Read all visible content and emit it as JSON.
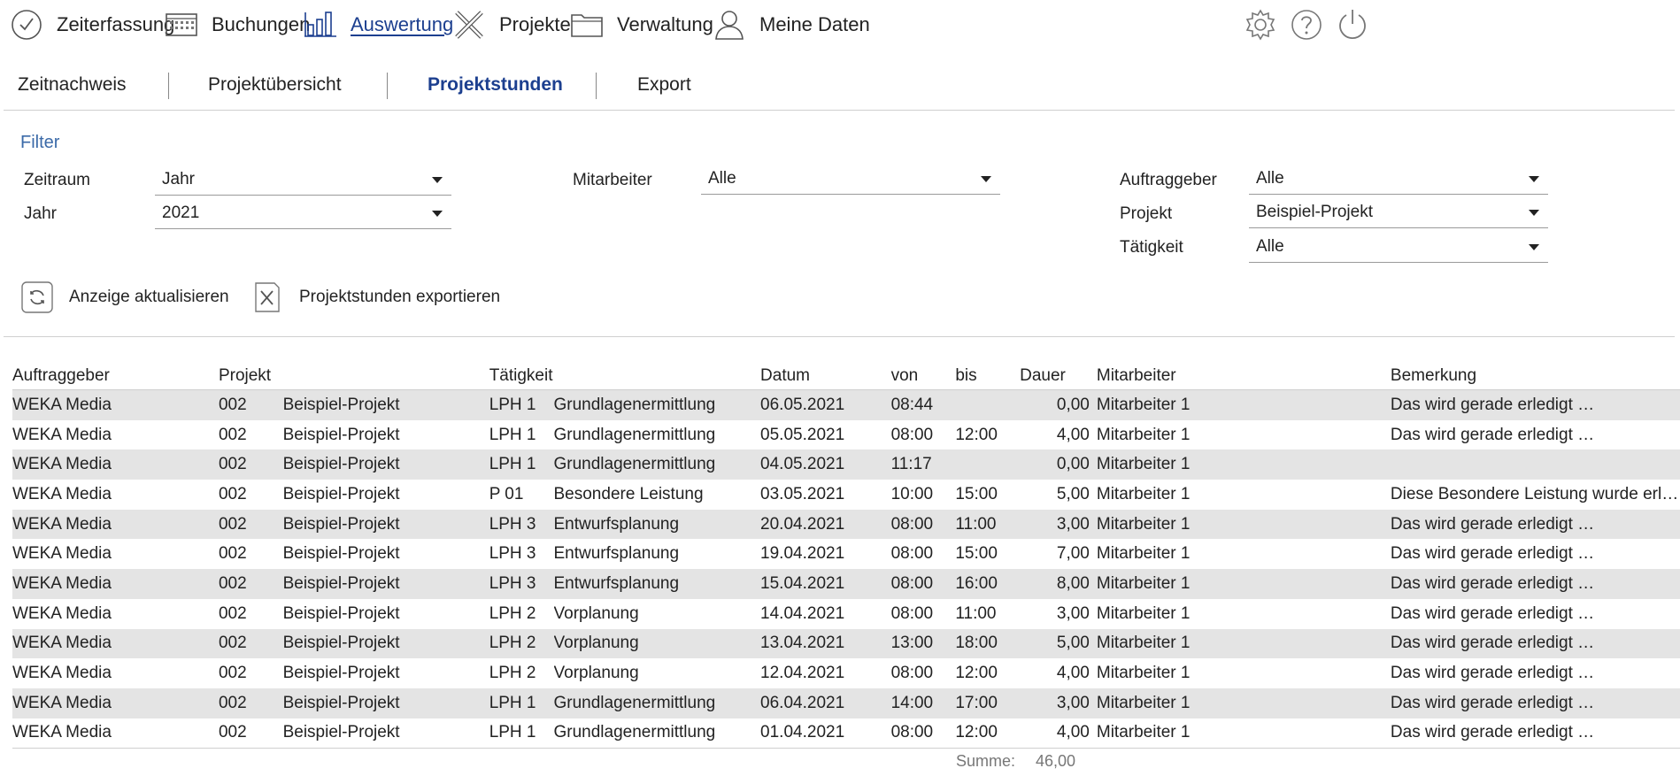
{
  "nav": {
    "items": [
      {
        "label": "Zeiterfassung",
        "icon": "clock-icon"
      },
      {
        "label": "Buchungen",
        "icon": "calendar-icon"
      },
      {
        "label": "Auswertung",
        "icon": "bar-chart-icon"
      },
      {
        "label": "Projekte",
        "icon": "pencil-ruler-icon"
      },
      {
        "label": "Verwaltung",
        "icon": "folder-icon"
      },
      {
        "label": "Meine Daten",
        "icon": "person-icon"
      }
    ],
    "active": "Auswertung",
    "right_icons": [
      "gear-icon",
      "help-icon",
      "power-icon"
    ]
  },
  "subnav": {
    "tabs": [
      "Zeitnachweis",
      "Projektübersicht",
      "Projektstunden",
      "Export"
    ],
    "active": "Projektstunden"
  },
  "filter": {
    "title": "Filter",
    "zeitraum": {
      "label": "Zeitraum",
      "value": "Jahr"
    },
    "jahr": {
      "label": "Jahr",
      "value": "2021"
    },
    "mitarbeiter": {
      "label": "Mitarbeiter",
      "value": "Alle"
    },
    "auftraggeber": {
      "label": "Auftraggeber",
      "value": "Alle"
    },
    "projekt": {
      "label": "Projekt",
      "value": "Beispiel-Projekt"
    },
    "taetigkeit": {
      "label": "Tätigkeit",
      "value": "Alle"
    }
  },
  "actions": {
    "refresh": "Anzeige aktualisieren",
    "export": "Projektstunden exportieren"
  },
  "table": {
    "headers": {
      "auftraggeber": "Auftraggeber",
      "projekt": "Projekt",
      "taetigkeit": "Tätigkeit",
      "datum": "Datum",
      "von": "von",
      "bis": "bis",
      "dauer": "Dauer",
      "mitarbeiter": "Mitarbeiter",
      "bemerkung": "Bemerkung"
    },
    "rows": [
      {
        "auftraggeber": "WEKA Media",
        "nr": "002",
        "projekt": "Beispiel-Projekt",
        "code": "LPH 1",
        "taetigkeit": "Grundlagenermittlung",
        "datum": "06.05.2021",
        "von": "08:44",
        "bis": "",
        "dauer": "0,00",
        "mitarbeiter": "Mitarbeiter 1",
        "bemerkung": "Das wird gerade erledigt …"
      },
      {
        "auftraggeber": "WEKA Media",
        "nr": "002",
        "projekt": "Beispiel-Projekt",
        "code": "LPH 1",
        "taetigkeit": "Grundlagenermittlung",
        "datum": "05.05.2021",
        "von": "08:00",
        "bis": "12:00",
        "dauer": "4,00",
        "mitarbeiter": "Mitarbeiter 1",
        "bemerkung": "Das wird gerade erledigt …"
      },
      {
        "auftraggeber": "WEKA Media",
        "nr": "002",
        "projekt": "Beispiel-Projekt",
        "code": "LPH 1",
        "taetigkeit": "Grundlagenermittlung",
        "datum": "04.05.2021",
        "von": "11:17",
        "bis": "",
        "dauer": "0,00",
        "mitarbeiter": "Mitarbeiter 1",
        "bemerkung": ""
      },
      {
        "auftraggeber": "WEKA Media",
        "nr": "002",
        "projekt": "Beispiel-Projekt",
        "code": "P 01",
        "taetigkeit": "Besondere Leistung",
        "datum": "03.05.2021",
        "von": "10:00",
        "bis": "15:00",
        "dauer": "5,00",
        "mitarbeiter": "Mitarbeiter 1",
        "bemerkung": "Diese Besondere Leistung wurde erl…"
      },
      {
        "auftraggeber": "WEKA Media",
        "nr": "002",
        "projekt": "Beispiel-Projekt",
        "code": "LPH 3",
        "taetigkeit": "Entwurfsplanung",
        "datum": "20.04.2021",
        "von": "08:00",
        "bis": "11:00",
        "dauer": "3,00",
        "mitarbeiter": "Mitarbeiter 1",
        "bemerkung": "Das wird gerade erledigt …"
      },
      {
        "auftraggeber": "WEKA Media",
        "nr": "002",
        "projekt": "Beispiel-Projekt",
        "code": "LPH 3",
        "taetigkeit": "Entwurfsplanung",
        "datum": "19.04.2021",
        "von": "08:00",
        "bis": "15:00",
        "dauer": "7,00",
        "mitarbeiter": "Mitarbeiter 1",
        "bemerkung": "Das wird gerade erledigt …"
      },
      {
        "auftraggeber": "WEKA Media",
        "nr": "002",
        "projekt": "Beispiel-Projekt",
        "code": "LPH 3",
        "taetigkeit": "Entwurfsplanung",
        "datum": "15.04.2021",
        "von": "08:00",
        "bis": "16:00",
        "dauer": "8,00",
        "mitarbeiter": "Mitarbeiter 1",
        "bemerkung": "Das wird gerade erledigt …"
      },
      {
        "auftraggeber": "WEKA Media",
        "nr": "002",
        "projekt": "Beispiel-Projekt",
        "code": "LPH 2",
        "taetigkeit": "Vorplanung",
        "datum": "14.04.2021",
        "von": "08:00",
        "bis": "11:00",
        "dauer": "3,00",
        "mitarbeiter": "Mitarbeiter 1",
        "bemerkung": "Das wird gerade erledigt …"
      },
      {
        "auftraggeber": "WEKA Media",
        "nr": "002",
        "projekt": "Beispiel-Projekt",
        "code": "LPH 2",
        "taetigkeit": "Vorplanung",
        "datum": "13.04.2021",
        "von": "13:00",
        "bis": "18:00",
        "dauer": "5,00",
        "mitarbeiter": "Mitarbeiter 1",
        "bemerkung": "Das wird gerade erledigt …"
      },
      {
        "auftraggeber": "WEKA Media",
        "nr": "002",
        "projekt": "Beispiel-Projekt",
        "code": "LPH 2",
        "taetigkeit": "Vorplanung",
        "datum": "12.04.2021",
        "von": "08:00",
        "bis": "12:00",
        "dauer": "4,00",
        "mitarbeiter": "Mitarbeiter 1",
        "bemerkung": "Das wird gerade erledigt …"
      },
      {
        "auftraggeber": "WEKA Media",
        "nr": "002",
        "projekt": "Beispiel-Projekt",
        "code": "LPH 1",
        "taetigkeit": "Grundlagenermittlung",
        "datum": "06.04.2021",
        "von": "14:00",
        "bis": "17:00",
        "dauer": "3,00",
        "mitarbeiter": "Mitarbeiter 1",
        "bemerkung": "Das wird gerade erledigt …"
      },
      {
        "auftraggeber": "WEKA Media",
        "nr": "002",
        "projekt": "Beispiel-Projekt",
        "code": "LPH 1",
        "taetigkeit": "Grundlagenermittlung",
        "datum": "01.04.2021",
        "von": "08:00",
        "bis": "12:00",
        "dauer": "4,00",
        "mitarbeiter": "Mitarbeiter 1",
        "bemerkung": "Das wird gerade erledigt …"
      }
    ],
    "summe_label": "Summe:",
    "summe_value": "46,00"
  },
  "colors": {
    "accent": "#1c3f8f",
    "filter_title": "#3b6aa8",
    "row_alt": "#e4e4e4"
  }
}
